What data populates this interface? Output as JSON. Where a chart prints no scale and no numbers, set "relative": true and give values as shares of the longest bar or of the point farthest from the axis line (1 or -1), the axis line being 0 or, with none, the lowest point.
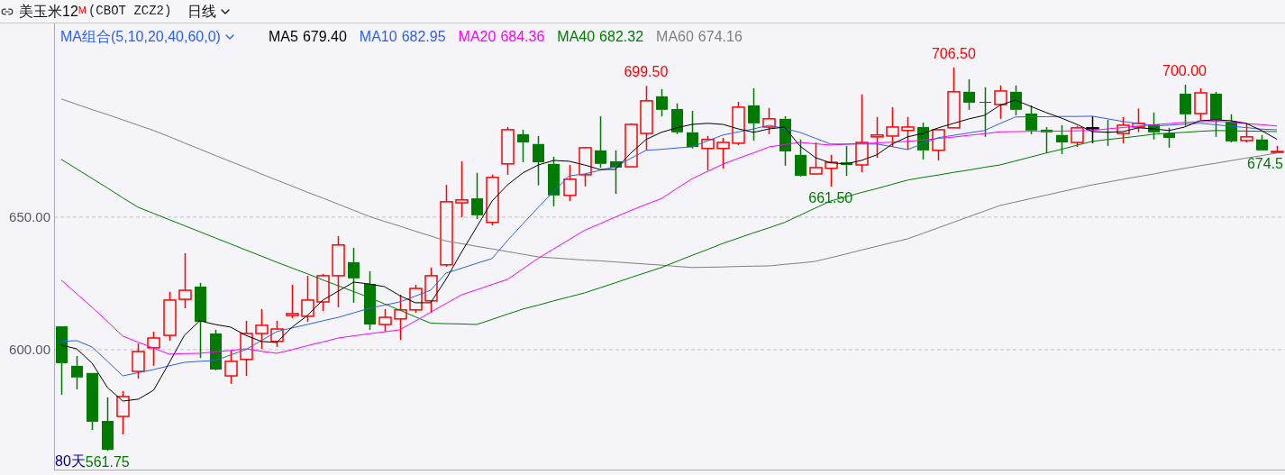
{
  "header": {
    "name": "美玉米12",
    "contract_mark": "M",
    "code": "(CBOT ZCZ2)",
    "period": "日线"
  },
  "range_label": "80天",
  "chart_data": {
    "type": "candlestick",
    "ylim": [
      554.4,
      723.1
    ],
    "yticks": [
      {
        "value": 650,
        "label": "650.00"
      },
      {
        "value": 600,
        "label": "600.00"
      }
    ],
    "categories": [
      null,
      null,
      null,
      null,
      null,
      null,
      null,
      null,
      null,
      null,
      null,
      null,
      null,
      null,
      null,
      null,
      null,
      null,
      null,
      null,
      null,
      null,
      null,
      null,
      null,
      null,
      null,
      null,
      null,
      null,
      null,
      null,
      null,
      null,
      null,
      null,
      null,
      null,
      null,
      null,
      null,
      null,
      null,
      null,
      null,
      null,
      null,
      null,
      null,
      null,
      null,
      null,
      null,
      null,
      null,
      null,
      null,
      null,
      null,
      null,
      null,
      null,
      null,
      null,
      null,
      null,
      null,
      null,
      null,
      null,
      null,
      null,
      null,
      null,
      null,
      null,
      null,
      null,
      null,
      null
    ],
    "ohlc": [
      [
        608.8,
        608.8,
        583.0,
        594.9
      ],
      [
        593.9,
        597.6,
        585.0,
        589.5
      ],
      [
        591.2,
        591.2,
        569.7,
        572.8
      ],
      [
        573.1,
        582.0,
        561.8,
        562.2
      ],
      [
        574.8,
        584.4,
        568.0,
        582.3
      ],
      [
        591.8,
        602.4,
        589.1,
        599.3
      ],
      [
        600.7,
        606.8,
        593.9,
        604.4
      ],
      [
        605.4,
        621.8,
        603.4,
        618.7
      ],
      [
        619.0,
        636.4,
        615.6,
        622.4
      ],
      [
        623.8,
        625.2,
        596.9,
        610.5
      ],
      [
        606.1,
        607.5,
        592.2,
        592.5
      ],
      [
        590.1,
        599.7,
        587.1,
        595.6
      ],
      [
        596.3,
        610.9,
        590.1,
        606.1
      ],
      [
        606.1,
        615.3,
        600.3,
        609.2
      ],
      [
        603.1,
        610.9,
        601.0,
        607.8
      ],
      [
        612.9,
        624.5,
        611.9,
        613.6
      ],
      [
        612.6,
        627.9,
        610.5,
        618.7
      ],
      [
        618.0,
        628.6,
        614.6,
        627.9
      ],
      [
        627.9,
        642.9,
        616.0,
        639.5
      ],
      [
        633.0,
        638.4,
        617.7,
        626.9
      ],
      [
        624.8,
        629.6,
        607.5,
        609.5
      ],
      [
        609.5,
        615.3,
        606.8,
        612.2
      ],
      [
        611.6,
        620.7,
        603.7,
        615.0
      ],
      [
        615.0,
        624.5,
        613.9,
        623.1
      ],
      [
        618.4,
        631.0,
        613.9,
        627.9
      ],
      [
        632.0,
        662.2,
        631.3,
        655.8
      ],
      [
        655.4,
        671.1,
        650.0,
        656.5
      ],
      [
        657.1,
        666.7,
        649.3,
        650.7
      ],
      [
        648.0,
        666.0,
        646.9,
        665.0
      ],
      [
        670.1,
        684.0,
        666.0,
        683.0
      ],
      [
        681.3,
        683.0,
        670.7,
        678.2
      ],
      [
        677.6,
        680.6,
        662.0,
        670.7
      ],
      [
        670.1,
        672.8,
        654.1,
        658.2
      ],
      [
        658.2,
        669.7,
        656.1,
        664.3
      ],
      [
        666.0,
        676.5,
        661.6,
        676.2
      ],
      [
        675.2,
        688.1,
        668.7,
        670.1
      ],
      [
        671.1,
        675.2,
        658.8,
        668.7
      ],
      [
        669.0,
        685.4,
        669.0,
        685.0
      ],
      [
        681.6,
        699.5,
        675.2,
        693.9
      ],
      [
        695.6,
        698.3,
        688.1,
        690.5
      ],
      [
        690.8,
        692.9,
        681.3,
        682.0
      ],
      [
        682.0,
        690.1,
        675.9,
        676.5
      ],
      [
        675.9,
        680.6,
        667.7,
        679.3
      ],
      [
        675.9,
        679.9,
        668.4,
        678.2
      ],
      [
        677.9,
        693.5,
        677.2,
        691.5
      ],
      [
        692.2,
        698.6,
        678.9,
        685.4
      ],
      [
        684.0,
        691.2,
        681.3,
        687.1
      ],
      [
        687.1,
        688.1,
        669.4,
        674.8
      ],
      [
        673.5,
        679.3,
        665.3,
        665.6
      ],
      [
        666.3,
        678.2,
        666.3,
        668.7
      ],
      [
        668.4,
        673.5,
        661.5,
        670.7
      ],
      [
        670.7,
        676.9,
        665.6,
        669.7
      ],
      [
        669.7,
        696.3,
        667.0,
        678.2
      ],
      [
        680.3,
        687.8,
        672.4,
        681.0
      ],
      [
        680.6,
        691.5,
        676.5,
        684.0
      ],
      [
        682.7,
        687.8,
        675.5,
        684.0
      ],
      [
        684.0,
        685.7,
        671.8,
        675.2
      ],
      [
        675.2,
        683.0,
        671.4,
        683.0
      ],
      [
        683.7,
        706.5,
        683.7,
        697.3
      ],
      [
        697.3,
        702.0,
        690.5,
        693.2
      ],
      [
        693.5,
        699.0,
        680.3,
        693.2
      ],
      [
        692.5,
        699.7,
        687.1,
        697.6
      ],
      [
        697.3,
        699.7,
        688.4,
        690.5
      ],
      [
        689.1,
        692.2,
        681.3,
        682.7
      ],
      [
        683.0,
        684.0,
        674.1,
        682.0
      ],
      [
        681.0,
        684.7,
        673.8,
        678.2
      ],
      [
        678.2,
        684.4,
        676.5,
        683.7
      ],
      [
        683.7,
        688.1,
        677.9,
        683.7
      ],
      [
        682.3,
        686.7,
        676.9,
        682.0
      ],
      [
        681.6,
        687.8,
        677.9,
        684.7
      ],
      [
        684.0,
        691.0,
        682.1,
        685.4
      ],
      [
        685.0,
        689.5,
        679.3,
        682.0
      ],
      [
        681.6,
        683.7,
        676.2,
        679.9
      ],
      [
        696.6,
        700.0,
        684.4,
        688.8
      ],
      [
        689.1,
        698.6,
        686.7,
        696.9
      ],
      [
        696.6,
        697.3,
        680.3,
        686.7
      ],
      [
        686.1,
        688.8,
        678.2,
        678.6
      ],
      [
        678.9,
        685.4,
        678.2,
        680.3
      ],
      [
        679.3,
        681.0,
        675.2,
        675.2
      ],
      [
        674.5,
        676.9,
        674.5,
        674.8
      ]
    ],
    "annotations": [
      {
        "text": "699.50",
        "y": 699.5
      },
      {
        "text": "706.50",
        "y": 706.5
      },
      {
        "text": "700.00",
        "y": 700.0
      },
      {
        "text": "661.50",
        "y": 661.5
      },
      {
        "text": "674.5",
        "y": 674.5
      },
      {
        "text": "561.75",
        "y": 561.8
      }
    ]
  },
  "moving_averages": {
    "title": "MA组合(5,10,20,40,60,0)",
    "values": [
      "679.40",
      "682.95",
      "684.36",
      "682.32",
      "674.16"
    ],
    "chart_data": {
      "type": "line",
      "relative": true,
      "ylim": [
        554.4,
        723.1
      ],
      "categories": [
        null,
        null,
        null,
        null,
        null,
        null,
        null,
        null,
        null,
        null,
        null,
        null,
        null,
        null,
        null,
        null,
        null,
        null,
        null,
        null,
        null,
        null,
        null,
        null,
        null,
        null,
        null,
        null,
        null,
        null,
        null,
        null,
        null,
        null,
        null,
        null,
        null,
        null,
        null,
        null,
        null,
        null,
        null,
        null,
        null,
        null,
        null,
        null,
        null,
        null,
        null,
        null,
        null,
        null,
        null,
        null,
        null,
        null,
        null,
        null,
        null,
        null,
        null,
        null,
        null,
        null,
        null,
        null,
        null,
        null,
        null,
        null,
        null,
        null,
        null,
        null,
        null,
        null,
        null,
        null
      ],
      "series": [
        {
          "name": "MA60",
          "color": "#808080",
          "values": [
            694.6,
            692.6,
            690.6,
            688.7,
            686.7,
            684.7,
            682.7,
            680.4,
            678.0,
            675.7,
            673.3,
            671.0,
            668.7,
            666.3,
            664.0,
            661.7,
            659.4,
            657.2,
            654.9,
            652.6,
            650.3,
            648.4,
            646.6,
            644.7,
            642.9,
            641.0,
            640.0,
            639.0,
            638.0,
            637.0,
            636.0,
            635.0,
            634.6,
            634.2,
            633.8,
            633.5,
            633.1,
            632.7,
            632.3,
            631.9,
            631.4,
            631.0,
            631.1,
            631.2,
            631.4,
            631.5,
            631.6,
            632.2,
            632.7,
            633.3,
            634.7,
            636.1,
            637.6,
            639.0,
            640.4,
            641.8,
            643.9,
            646.0,
            648.1,
            650.2,
            652.3,
            654.4,
            655.7,
            657.0,
            658.3,
            659.6,
            660.9,
            662.2,
            663.2,
            664.3,
            665.3,
            666.3,
            667.4,
            668.4,
            669.4,
            670.3,
            671.3,
            672.3,
            673.2,
            674.2
          ]
        },
        {
          "name": "MA40",
          "color": "#007a00",
          "values": [
            671.8,
            668.2,
            664.6,
            661.0,
            657.3,
            653.7,
            651.4,
            649.1,
            646.8,
            644.5,
            642.2,
            639.9,
            637.6,
            635.3,
            633.0,
            630.8,
            628.6,
            626.3,
            624.1,
            621.9,
            619.7,
            617.3,
            614.9,
            612.4,
            610.0,
            609.8,
            609.7,
            609.5,
            611.4,
            613.4,
            615.3,
            616.8,
            618.4,
            619.9,
            621.4,
            623.3,
            625.2,
            627.2,
            629.1,
            631.0,
            633.3,
            635.6,
            637.8,
            640.1,
            642.1,
            644.1,
            646.0,
            648.0,
            650.7,
            653.4,
            656.1,
            657.7,
            659.3,
            660.8,
            662.4,
            664.0,
            665.0,
            665.9,
            666.9,
            667.8,
            668.8,
            669.7,
            671.2,
            672.7,
            674.2,
            675.6,
            677.1,
            678.6,
            679.3,
            679.9,
            680.6,
            681.3,
            681.7,
            682.0,
            682.4,
            682.7,
            682.6,
            682.5,
            682.4,
            682.3
          ]
        },
        {
          "name": "MA20",
          "color": "#ff00ff",
          "values": [
            626.2,
            621.1,
            616.0,
            610.6,
            605.1,
            602.8,
            600.6,
            598.3,
            598.5,
            598.6,
            599.2,
            599.7,
            600.3,
            599.4,
            598.6,
            600.0,
            601.5,
            602.9,
            604.4,
            605.2,
            606.0,
            606.7,
            607.5,
            610.8,
            614.1,
            617.4,
            620.7,
            622.6,
            624.6,
            626.5,
            630.5,
            634.5,
            638.0,
            641.5,
            645.0,
            647.5,
            650.0,
            652.5,
            654.8,
            657.0,
            660.8,
            664.5,
            667.3,
            670.0,
            672.2,
            674.3,
            676.5,
            677.4,
            678.2,
            677.7,
            677.2,
            677.5,
            677.8,
            678.0,
            678.3,
            678.6,
            679.1,
            679.7,
            680.2,
            680.9,
            681.5,
            682.2,
            682.3,
            682.4,
            682.4,
            682.5,
            682.6,
            682.7,
            683.3,
            683.8,
            684.4,
            684.9,
            685.3,
            685.8,
            686.0,
            686.2,
            685.8,
            685.3,
            684.9,
            684.4
          ]
        },
        {
          "name": "MA10",
          "color": "#2f5fe6",
          "values": [
            603.1,
            603.4,
            601.0,
            595.6,
            590.1,
            591.3,
            592.5,
            593.9,
            595.2,
            595.6,
            595.9,
            598.0,
            600.0,
            603.4,
            606.8,
            608.2,
            609.5,
            610.9,
            612.2,
            613.9,
            615.6,
            616.8,
            618.0,
            620.2,
            622.4,
            628.9,
            630.7,
            632.6,
            634.4,
            641.2,
            647.5,
            653.7,
            659.7,
            665.6,
            666.3,
            667.7,
            669.0,
            672.1,
            675.2,
            675.6,
            676.1,
            676.5,
            678.8,
            681.0,
            682.2,
            683.3,
            684.7,
            683.4,
            682.0,
            679.8,
            677.6,
            677.6,
            677.6,
            677.6,
            676.6,
            675.5,
            677.8,
            680.0,
            680.9,
            681.8,
            682.7,
            685.3,
            687.8,
            687.9,
            687.9,
            688.0,
            688.0,
            688.1,
            687.1,
            686.1,
            685.3,
            684.4,
            684.7,
            685.1,
            685.4,
            684.9,
            684.3,
            683.8,
            683.2,
            683.0
          ]
        },
        {
          "name": "MA5",
          "color": "#000000",
          "values": [
            601.7,
            600.3,
            594.9,
            585.7,
            580.6,
            581.3,
            584.7,
            594.9,
            605.4,
            610.9,
            609.5,
            608.5,
            605.4,
            603.1,
            602.7,
            608.5,
            612.9,
            618.7,
            622.1,
            625.5,
            624.8,
            623.8,
            620.4,
            617.7,
            617.7,
            626.5,
            636.7,
            646.3,
            656.1,
            662.2,
            666.7,
            669.7,
            671.4,
            671.1,
            669.7,
            668.0,
            668.0,
            674.1,
            679.3,
            682.0,
            683.7,
            685.0,
            685.4,
            685.0,
            683.3,
            682.0,
            683.3,
            684.0,
            676.9,
            672.5,
            670.5,
            670.1,
            671.4,
            673.5,
            677.6,
            680.3,
            681.6,
            683.7,
            685.4,
            687.1,
            688.4,
            692.2,
            694.2,
            691.8,
            689.5,
            687.4,
            685.0,
            682.3,
            682.0,
            682.3,
            683.7,
            683.3,
            682.7,
            684.0,
            686.4,
            686.7,
            686.4,
            685.4,
            682.7,
            679.4
          ]
        }
      ],
      "stacked": null
    }
  }
}
